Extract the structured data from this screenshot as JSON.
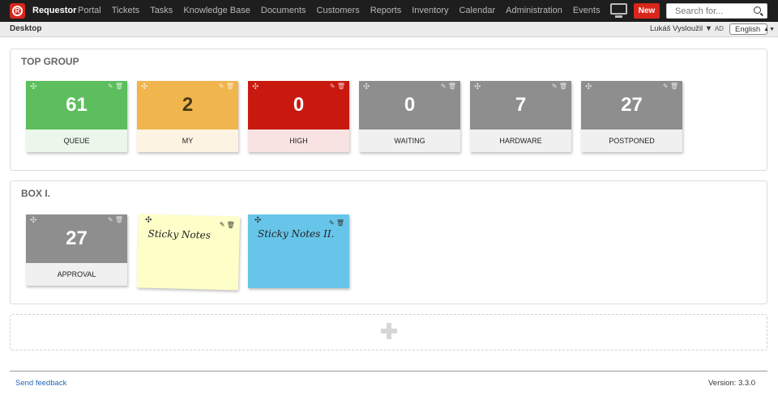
{
  "app": {
    "brand": "Requestor",
    "logo_letter": "R"
  },
  "nav": [
    "Portal",
    "Tickets",
    "Tasks",
    "Knowledge Base",
    "Documents",
    "Customers",
    "Reports",
    "Inventory",
    "Calendar",
    "Administration",
    "Events"
  ],
  "topbar": {
    "new_label": "New",
    "search_placeholder": "Search for..."
  },
  "subbar": {
    "title": "Desktop",
    "user": "Lukáš Vysloužil ▼",
    "user_suffix": "AD",
    "language": "English"
  },
  "groups": [
    {
      "title": "TOP GROUP",
      "tiles": [
        {
          "value": "61",
          "label": "QUEUE",
          "color": "#5cbe5c",
          "bottom_color": "#eaf7ea"
        },
        {
          "value": "2",
          "label": "MY",
          "color": "#f0b54d",
          "bottom_color": "#fdf3e3",
          "value_color": "#4a3a1a"
        },
        {
          "value": "0",
          "label": "HIGH",
          "color": "#c9190f",
          "bottom_color": "#f8e2e2"
        },
        {
          "value": "0",
          "label": "WAITING",
          "color": "#8e8e8e",
          "bottom_color": "#f0f0f0"
        },
        {
          "value": "7",
          "label": "HARDWARE",
          "color": "#8e8e8e",
          "bottom_color": "#f0f0f0"
        },
        {
          "value": "27",
          "label": "POSTPONED",
          "color": "#8e8e8e",
          "bottom_color": "#f0f0f0"
        }
      ]
    },
    {
      "title": "BOX I.",
      "tiles": [
        {
          "value": "27",
          "label": "APPROVAL",
          "color": "#8e8e8e",
          "bottom_color": "#f0f0f0"
        }
      ],
      "notes": [
        {
          "text": "Sticky Notes",
          "color": "#fefec8"
        },
        {
          "text": "Sticky Notes II.",
          "color": "#67c5ea"
        }
      ]
    }
  ],
  "footer": {
    "feedback": "Send feedback",
    "version": "Version: 3.3.0"
  }
}
